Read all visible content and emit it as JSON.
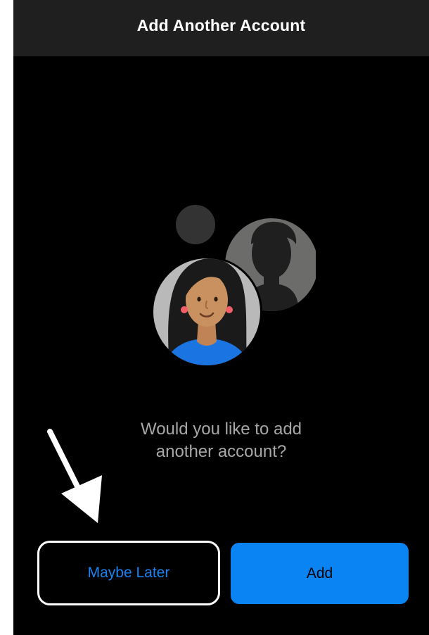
{
  "header": {
    "title": "Add Another Account"
  },
  "illustration": {
    "icons": [
      "small-dot-icon",
      "silhouette-avatar-icon",
      "woman-avatar-icon"
    ]
  },
  "prompt": {
    "line1": "Would you like to add",
    "line2": "another account?"
  },
  "buttons": {
    "maybe_later": "Maybe Later",
    "add": "Add"
  },
  "colors": {
    "accent": "#0a84f3",
    "link_blue": "#1a83f0",
    "header_bg": "#1f1f1f",
    "prompt_text": "#a7a7a7"
  }
}
